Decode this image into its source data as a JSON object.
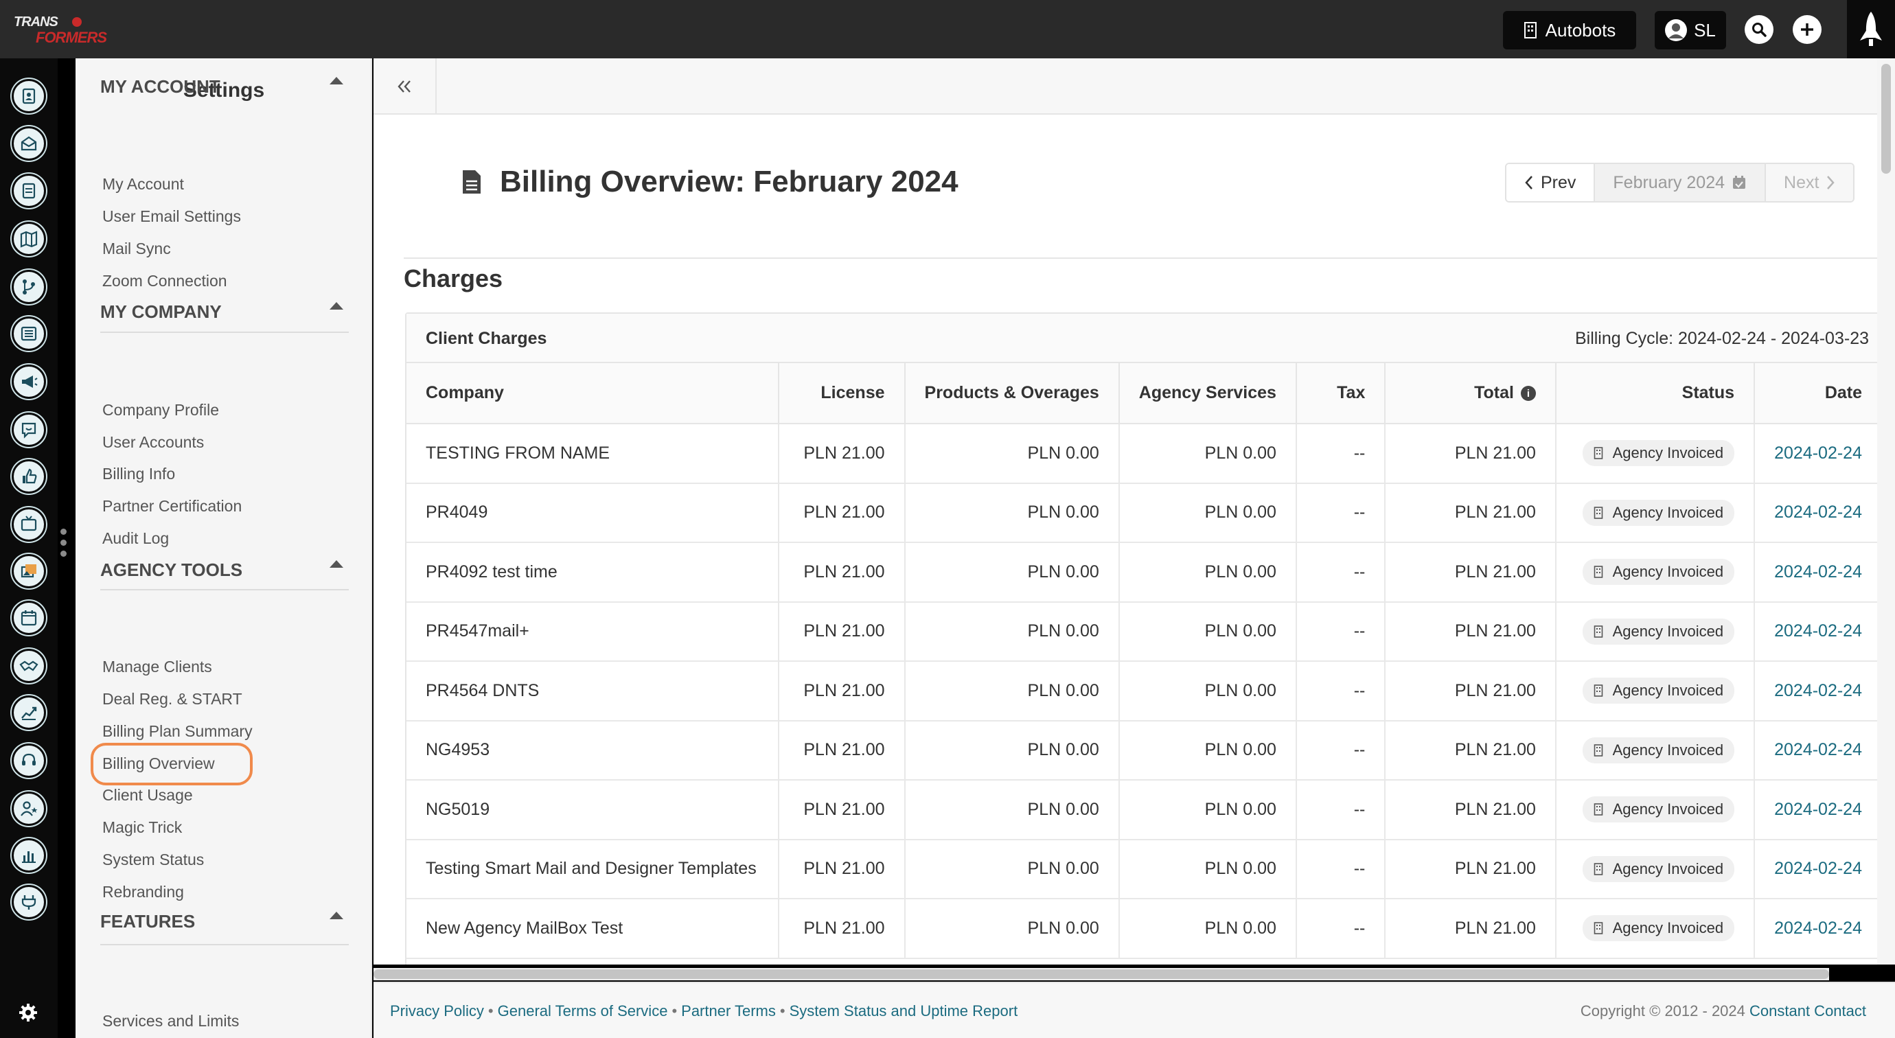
{
  "topbar": {
    "logo_text": "TRANSFORMERS",
    "agency_label": "Autobots",
    "user_initials": "SL"
  },
  "rail": {
    "icons": [
      "contacts-icon",
      "campaigns-icon",
      "reports-icon",
      "map-icon",
      "branch-icon",
      "list-icon",
      "megaphone-icon",
      "chat-icon",
      "thumbs-up-icon",
      "tv-icon",
      "image-gallery-icon",
      "calendar-icon",
      "handshake-icon",
      "growth-chart-icon",
      "support-headset-icon",
      "user-star-icon",
      "bar-chart-icon",
      "plug-icon"
    ]
  },
  "settings": {
    "title": "Settings",
    "sections": [
      {
        "heading": "MY ACCOUNT",
        "links": [
          "My Account",
          "User Email Settings",
          "Mail Sync",
          "Zoom Connection"
        ]
      },
      {
        "heading": "MY COMPANY",
        "links": [
          "Company Profile",
          "User Accounts",
          "Billing Info",
          "Partner Certification",
          "Audit Log"
        ]
      },
      {
        "heading": "AGENCY TOOLS",
        "links": [
          "Manage Clients",
          "Deal Reg. & START",
          "Billing Plan Summary",
          "Billing Overview",
          "Client Usage",
          "Magic Trick",
          "System Status",
          "Rebranding"
        ]
      },
      {
        "heading": "FEATURES",
        "links": [
          "Services and Limits"
        ]
      }
    ],
    "active_link": "Billing Overview"
  },
  "main": {
    "page_title": "Billing Overview: February 2024",
    "pager": {
      "prev": "Prev",
      "month": "February 2024",
      "next": "Next"
    },
    "section_title": "Charges",
    "card_title": "Client Charges",
    "billing_cycle": "Billing Cycle: 2024-02-24 - 2024-03-23",
    "columns": [
      "Company",
      "License",
      "Products & Overages",
      "Agency Services",
      "Tax",
      "Total",
      "Status",
      "Date"
    ],
    "rows": [
      [
        "TESTING FROM NAME",
        "PLN 21.00",
        "PLN 0.00",
        "PLN 0.00",
        "--",
        "PLN 21.00",
        "Agency Invoiced",
        "2024-02-24"
      ],
      [
        "PR4049",
        "PLN 21.00",
        "PLN 0.00",
        "PLN 0.00",
        "--",
        "PLN 21.00",
        "Agency Invoiced",
        "2024-02-24"
      ],
      [
        "PR4092 test time",
        "PLN 21.00",
        "PLN 0.00",
        "PLN 0.00",
        "--",
        "PLN 21.00",
        "Agency Invoiced",
        "2024-02-24"
      ],
      [
        "PR4547mail+",
        "PLN 21.00",
        "PLN 0.00",
        "PLN 0.00",
        "--",
        "PLN 21.00",
        "Agency Invoiced",
        "2024-02-24"
      ],
      [
        "PR4564 DNTS",
        "PLN 21.00",
        "PLN 0.00",
        "PLN 0.00",
        "--",
        "PLN 21.00",
        "Agency Invoiced",
        "2024-02-24"
      ],
      [
        "NG4953",
        "PLN 21.00",
        "PLN 0.00",
        "PLN 0.00",
        "--",
        "PLN 21.00",
        "Agency Invoiced",
        "2024-02-24"
      ],
      [
        "NG5019",
        "PLN 21.00",
        "PLN 0.00",
        "PLN 0.00",
        "--",
        "PLN 21.00",
        "Agency Invoiced",
        "2024-02-24"
      ],
      [
        "Testing Smart Mail and Designer Templates",
        "PLN 21.00",
        "PLN 0.00",
        "PLN 0.00",
        "--",
        "PLN 21.00",
        "Agency Invoiced",
        "2024-02-24"
      ],
      [
        "New Agency MailBox Test",
        "PLN 21.00",
        "PLN 0.00",
        "PLN 0.00",
        "--",
        "PLN 21.00",
        "Agency Invoiced",
        "2024-02-24"
      ]
    ]
  },
  "footer": {
    "links": [
      "Privacy Policy",
      "General Terms of Service",
      "Partner Terms",
      "System Status and Uptime Report"
    ],
    "copyright": "Copyright © 2012 - 2024",
    "brand": "Constant Contact"
  },
  "colors": {
    "topbar": "#2a2a2a",
    "link": "#1b6b80",
    "active_ring": "#f08a4b"
  }
}
